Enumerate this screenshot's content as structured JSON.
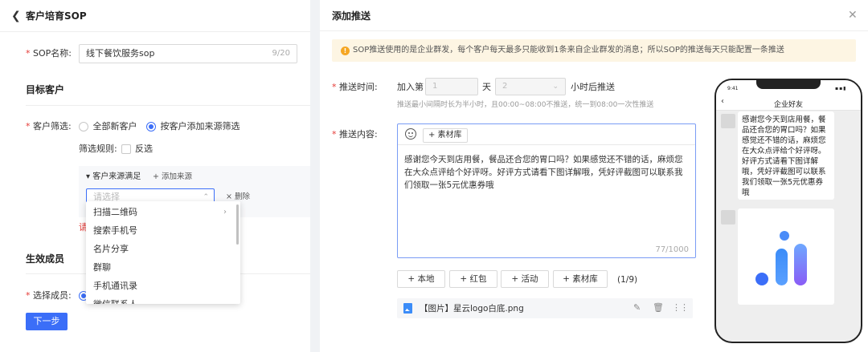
{
  "left": {
    "title": "客户培育SOP",
    "sop_name": {
      "required": "*",
      "label": "SOP名称:",
      "value": "线下餐饮服务sop",
      "count": "9/20"
    },
    "target_title": "目标客户",
    "filter": {
      "required": "*",
      "label": "客户筛选:",
      "options": [
        "全部新客户",
        "按客户添加来源筛选"
      ],
      "selected_index": 1,
      "rule_label": "筛选规则:",
      "reverse_label": "反选"
    },
    "source": {
      "heading": "▾ 客户来源满足",
      "add": "+ 添加来源",
      "placeholder": "请选择",
      "delete": "× 删除",
      "error_partial": "请"
    },
    "dropdown_items": [
      "扫描二维码",
      "搜索手机号",
      "名片分享",
      "群聊",
      "手机通讯录",
      "微信联系人"
    ],
    "members_title": "生效成员",
    "members": {
      "required": "*",
      "label": "选择成员:"
    },
    "next_button": "下一步"
  },
  "right": {
    "title": "添加推送",
    "notice": "SOP推送使用的是企业群发，每个客户每天最多只能收到1条来自企业群发的消息；所以SOP的推送每天只能配置一条推送",
    "time": {
      "required": "*",
      "label": "推送时间:",
      "prefix": "加入第",
      "day_value": "1",
      "day_unit": "天",
      "hour_value": "2",
      "suffix": "小时后推送",
      "hint": "推送最小间隔时长为半小时，且00:00~08:00不推送，统一到08:00一次性推送"
    },
    "content": {
      "required": "*",
      "label": "推送内容:",
      "library_button": "+ 素材库",
      "text": "感谢您今天到店用餐，餐品还合您的胃口吗？如果感觉还不错的话，麻烦您在大众点评给个好评呀。好评方式请看下图详解哦，凭好评截图可以联系我们领取一张5元优惠券哦",
      "count": "77/1000"
    },
    "attach_buttons": [
      "+ 本地",
      "+ 红包",
      "+ 活动",
      "+ 素材库"
    ],
    "attach_count": "(1/9)",
    "file_name": "【图片】星云logo白底.png",
    "phone": {
      "time": "9:41",
      "title": "企业好友",
      "message": "感谢您今天到店用餐，餐品还合您的胃口吗？如果感觉还不错的话，麻烦您在大众点评给个好评呀。好评方式请看下图详解哦，凭好评截图可以联系我们领取一张5元优惠券哦"
    }
  },
  "colors": {
    "primary": "#3b6ef8",
    "required": "#e53935",
    "notice_bg": "#fdf5e3",
    "warn": "#f5a623"
  },
  "icons": [
    "back-icon",
    "close-icon",
    "warning-icon",
    "smile-icon",
    "chevron-down-icon",
    "chevron-up-icon",
    "chevron-right-icon",
    "image-file-icon",
    "edit-icon",
    "delete-icon",
    "drag-handle-icon",
    "logo-icon"
  ]
}
